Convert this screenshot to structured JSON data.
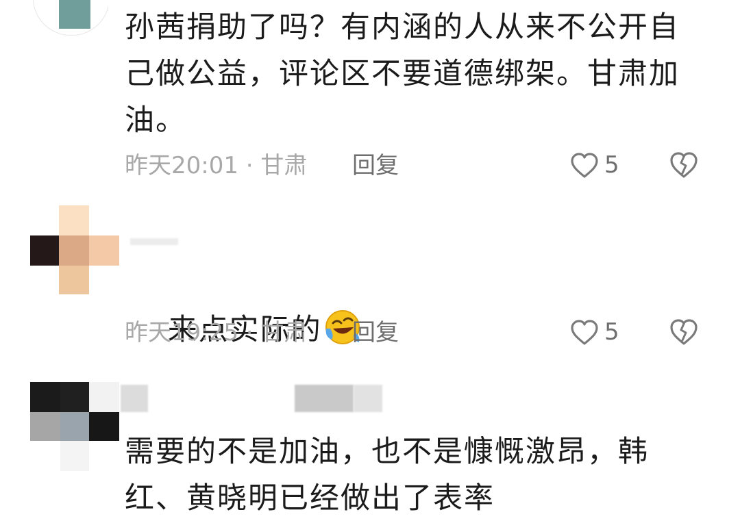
{
  "comments": [
    {
      "text": "孙茜捐助了吗？有内涵的人从来不公开自己做公益，评论区不要道德绑架。甘肃加油。",
      "meta": "昨天20:01 · 甘肃",
      "reply_label": "回复",
      "like_count": "5"
    },
    {
      "text": "来点实际的",
      "emoji": "rolling-on-floor-laughing-emoji",
      "meta": "昨天19:25 · 甘肃",
      "reply_label": "回复",
      "like_count": "5"
    },
    {
      "text": "需要的不是加油，也不是慷慨激昂，韩红、黄晓明已经做出了表率"
    }
  ],
  "colors": {
    "text": "#1b1b1b",
    "meta": "#a8a8a8",
    "action": "#6e6e6e",
    "icon": "#7a7a7a"
  },
  "icons": {
    "like": "heart-outline-icon",
    "dislike": "broken-heart-outline-icon"
  }
}
